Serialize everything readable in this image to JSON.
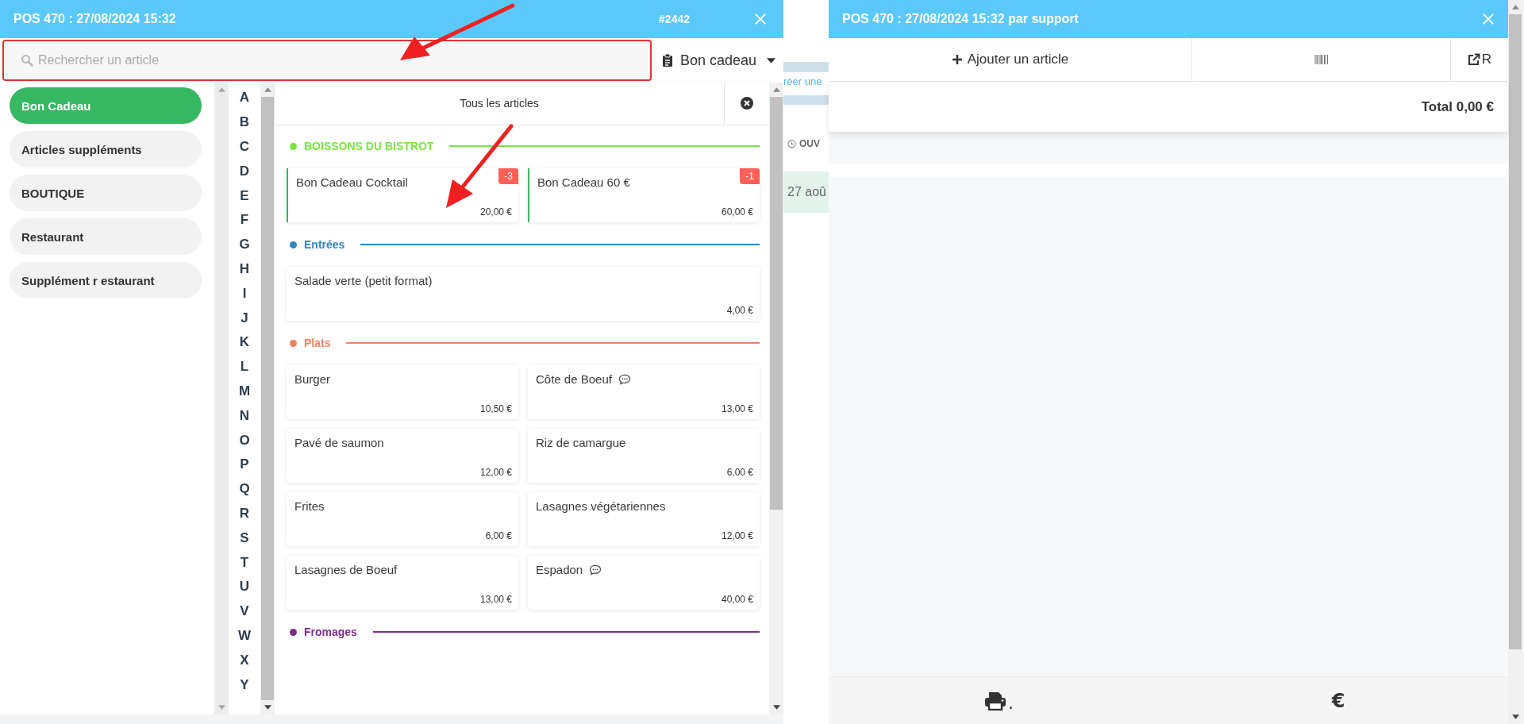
{
  "left_window": {
    "title": "POS 470 : 27/08/2024 15:32",
    "order_number": "#2442",
    "search": {
      "placeholder": "Rechercher un article"
    },
    "type_dropdown": {
      "value": "Bon cadeau"
    },
    "categories": [
      {
        "label": "Bon Cadeau",
        "selected": true
      },
      {
        "label": "Articles suppléments",
        "selected": false
      },
      {
        "label": "BOUTIQUE",
        "selected": false
      },
      {
        "label": "Restaurant",
        "selected": false
      },
      {
        "label": "Supplément r estaurant",
        "selected": false
      }
    ],
    "alphabet": [
      "A",
      "B",
      "C",
      "D",
      "E",
      "F",
      "G",
      "H",
      "I",
      "J",
      "K",
      "L",
      "M",
      "N",
      "O",
      "P",
      "Q",
      "R",
      "S",
      "T",
      "U",
      "V",
      "W",
      "X",
      "Y"
    ],
    "filter": {
      "label": "Tous les articles"
    },
    "sections": [
      {
        "name": "BOISSONS DU BISTROT",
        "color": "#78e83a",
        "products": [
          {
            "name": "Bon Cadeau Cocktail",
            "price": "20,00 €",
            "badge": "-3",
            "gift_card": true,
            "has_comment": false
          },
          {
            "name": "Bon Cadeau 60 €",
            "price": "60,00 €",
            "badge": "-1",
            "gift_card": true,
            "has_comment": false
          }
        ]
      },
      {
        "name": "Entrées",
        "color": "#2f86c4",
        "products": [
          {
            "name": "Salade verte (petit format)",
            "price": "4,00 €",
            "gift_card": false,
            "has_comment": false
          }
        ]
      },
      {
        "name": "Plats",
        "color": "#f2805e",
        "products": [
          {
            "name": "Burger",
            "price": "10,50 €",
            "gift_card": false,
            "has_comment": false
          },
          {
            "name": "Côte de Boeuf",
            "price": "13,00 €",
            "gift_card": false,
            "has_comment": true
          },
          {
            "name": "Pavé de saumon",
            "price": "12,00 €",
            "gift_card": false,
            "has_comment": false
          },
          {
            "name": "Riz de camargue",
            "price": "6,00 €",
            "gift_card": false,
            "has_comment": false
          },
          {
            "name": "Frites",
            "price": "6,00 €",
            "gift_card": false,
            "has_comment": false
          },
          {
            "name": "Lasagnes végétariennes",
            "price": "12,00 €",
            "gift_card": false,
            "has_comment": false
          },
          {
            "name": "Lasagnes de Boeuf",
            "price": "13,00 €",
            "gift_card": false,
            "has_comment": false
          },
          {
            "name": "Espadon",
            "price": "40,00 €",
            "gift_card": false,
            "has_comment": true
          }
        ]
      },
      {
        "name": "Fromages",
        "color": "#7b2c8c"
      }
    ]
  },
  "background_page": {
    "link_text": "réer une",
    "status_label": "OUV",
    "date_text": "27 aoû"
  },
  "right_window": {
    "title": "POS 470 : 27/08/2024 15:32 par support",
    "add_button": "Ajouter un article",
    "external_button": "R",
    "total": "Total 0,00 €",
    "print_suffix": ".",
    "pay_button": "€"
  }
}
